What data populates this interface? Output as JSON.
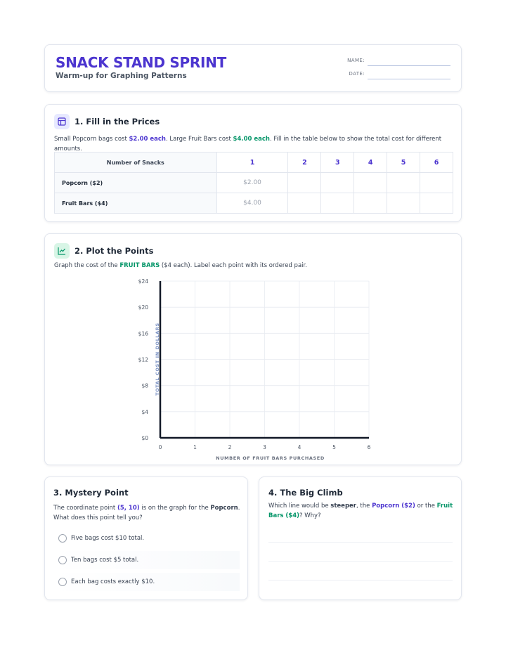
{
  "header": {
    "title": "SNACK STAND SPRINT",
    "subtitle": "Warm-up for Graphing Patterns",
    "name_label": "NAME:",
    "date_label": "DATE:"
  },
  "section1": {
    "icon": "table-icon",
    "title": "1. Fill in the Prices",
    "text_a": "Small Popcorn bags cost ",
    "price_a": "$2.00 each",
    "text_b": ". Large Fruit Bars cost ",
    "price_b": "$4.00 each",
    "text_c": ". Fill in the table below to show the total cost for different amounts.",
    "table": {
      "header": "Number of Snacks",
      "columns": [
        "1",
        "2",
        "3",
        "4",
        "5",
        "6"
      ],
      "rows": [
        {
          "label": "Popcorn ($2)",
          "values": [
            "$2.00",
            "",
            "",
            "",
            "",
            ""
          ]
        },
        {
          "label": "Fruit Bars ($4)",
          "values": [
            "$4.00",
            "",
            "",
            "",
            "",
            ""
          ]
        }
      ]
    }
  },
  "section2": {
    "icon": "line-chart-icon",
    "title": "2. Plot the Points",
    "text_a": "Graph the cost of the ",
    "highlight": "FRUIT BARS",
    "text_b": " ($4 each). Label each point with its ordered pair."
  },
  "chart_data": {
    "type": "scatter",
    "title": "",
    "xlabel": "NUMBER OF FRUIT BARS PURCHASED",
    "ylabel": "TOTAL COST IN DOLLARS",
    "xlim": [
      0,
      6
    ],
    "ylim": [
      0,
      24
    ],
    "x_ticks": [
      "0",
      "1",
      "2",
      "3",
      "4",
      "5",
      "6"
    ],
    "y_ticks": [
      "$0",
      "$4",
      "$8",
      "$12",
      "$16",
      "$20",
      "$24"
    ],
    "grid": true,
    "series": []
  },
  "section3": {
    "title": "3. Mystery Point",
    "text_a": "The coordinate point ",
    "point": "(5, 10)",
    "text_b": " is on the graph for the ",
    "item": "Popcorn",
    "text_c": ". What does this point tell you?",
    "options": [
      "Five bags cost $10 total.",
      "Ten bags cost $5 total.",
      "Each bag costs exactly $10."
    ]
  },
  "section4": {
    "title": "4. The Big Climb",
    "text_a": "Which line would be ",
    "steeper": "steeper",
    "text_b": ", the ",
    "popcorn": "Popcorn ($2)",
    "text_c": " or the ",
    "fruit": "Fruit Bars ($4)",
    "text_d": "? Why?"
  },
  "colors": {
    "accent": "#4c35cf",
    "green": "#059669",
    "axis": "#111827",
    "grid": "#e8ebf1"
  }
}
